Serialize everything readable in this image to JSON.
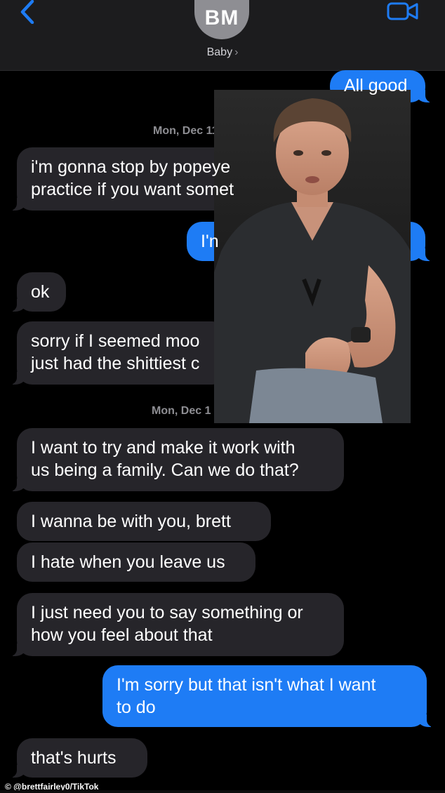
{
  "header": {
    "avatar_initials": "BM",
    "contact_name": "Baby",
    "contact_chevron": "›",
    "back_icon": "chevron-left",
    "video_icon": "video-camera",
    "accent_color": "#1e7cf5"
  },
  "messages": [
    {
      "id": "m1",
      "side": "out",
      "text": "All good"
    },
    {
      "id": "ts1",
      "type": "timestamp",
      "text": "Mon, Dec 11 a"
    },
    {
      "id": "m2",
      "side": "in",
      "text": "i'm gonna stop by popeye\npractice if you want somet"
    },
    {
      "id": "m3",
      "side": "out",
      "text": "I'n"
    },
    {
      "id": "m4",
      "side": "in",
      "text": "ok"
    },
    {
      "id": "m5",
      "side": "in",
      "text": "sorry if I seemed moo\njust had the shittiest c"
    },
    {
      "id": "ts2",
      "type": "timestamp",
      "text": "Mon, Dec 1"
    },
    {
      "id": "m6",
      "side": "in",
      "text": "I want to try and make it work with\nus being a family. Can we do that?"
    },
    {
      "id": "m7",
      "side": "in",
      "text": "I wanna be with you, brett"
    },
    {
      "id": "m8",
      "side": "in",
      "text": "I hate when you leave us"
    },
    {
      "id": "m9",
      "side": "in",
      "text": "I just need you to say something or\nhow you feel about that"
    },
    {
      "id": "m10",
      "side": "out",
      "text": "I'm sorry but that isn't what I want\nto do"
    },
    {
      "id": "m11",
      "side": "in",
      "text": "that's hurts"
    }
  ],
  "overlay": {
    "description_icon": "person-photo"
  },
  "watermark": "© @brettfairley0/TikTok"
}
